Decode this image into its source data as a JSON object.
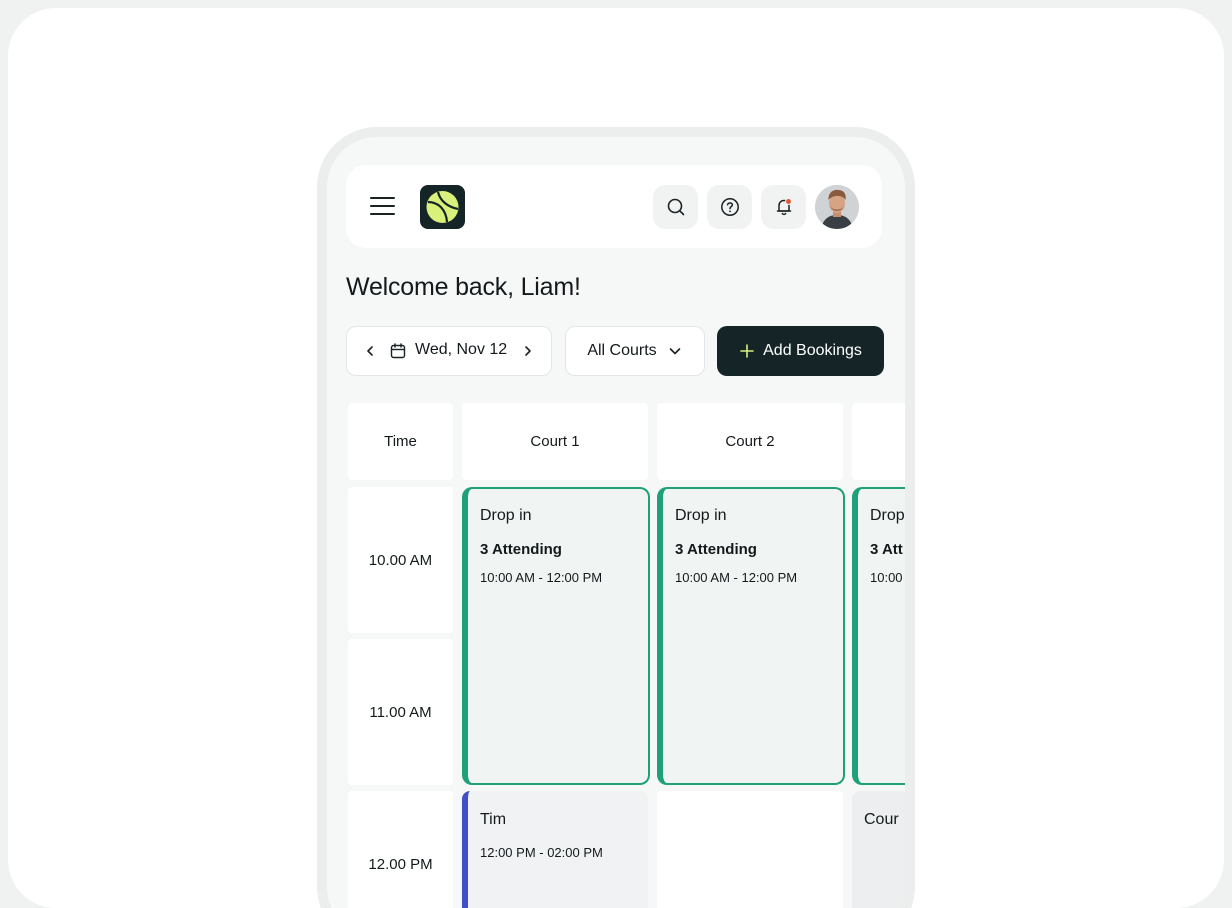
{
  "colors": {
    "brand_dark": "#152427",
    "accent_green": "#1fa078",
    "accent_blue": "#3f4fc7",
    "logo_ball": "#d9f07a",
    "notification_dot": "#e0593a"
  },
  "header": {
    "menu_icon": "hamburger-menu-icon",
    "logo_icon": "tennis-ball-icon",
    "icons": [
      "search-icon",
      "help-circle-icon",
      "bell-icon"
    ],
    "avatar_alt": "user-avatar"
  },
  "welcome": "Welcome back, Liam!",
  "toolbar": {
    "date_label": "Wed, Nov 12",
    "courts_label": "All Courts",
    "add_label": "Add Bookings"
  },
  "schedule": {
    "time_header": "Time",
    "courts": [
      "Court 1",
      "Court 2"
    ],
    "times": [
      "10.00 AM",
      "11.00 AM",
      "12.00 PM"
    ],
    "events": [
      {
        "title": "Drop in",
        "attending": "3 Attending",
        "time": "10:00 AM - 12:00 PM"
      },
      {
        "title": "Drop in",
        "attending": "3 Attending",
        "time": "10:00 AM - 12:00 PM"
      },
      {
        "title": "Drop",
        "attending": "3 Att",
        "time": "10:00"
      },
      {
        "title": "Tim",
        "time": "12:00 PM - 02:00 PM"
      },
      {
        "title": "Cour"
      }
    ]
  }
}
